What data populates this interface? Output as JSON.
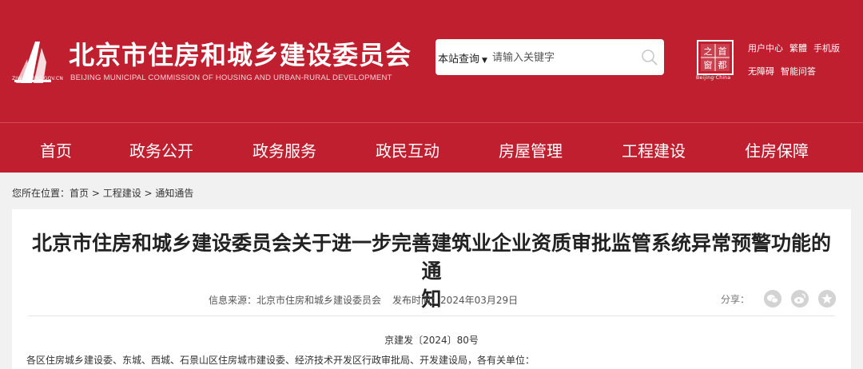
{
  "header": {
    "logo_domain": "ZJW.BEIJING.GOV.CN",
    "title": "北京市住房和城乡建设委员会",
    "subtitle": "BEIJING MUNICIPAL COMMISSION OF HOUSING AND URBAN-RURAL DEVELOPMENT",
    "seal_glyphs": [
      "首",
      "都",
      "之",
      "窗"
    ],
    "seal_caption": "Beijing·China"
  },
  "search": {
    "scope_label": "本站查询",
    "placeholder": "请输入关键字"
  },
  "top_links": {
    "user_center": "用户中心",
    "traditional": "繁體",
    "mobile": "手机版",
    "accessible": "无障碍",
    "smart_qa": "智能问答"
  },
  "nav": [
    "首页",
    "政务公开",
    "政务服务",
    "政民互动",
    "房屋管理",
    "工程建设",
    "住房保障"
  ],
  "breadcrumb": {
    "prefix": "您所在位置：",
    "home": "首页",
    "sep1": " > ",
    "section": "工程建设",
    "sep2": " > ",
    "current": "通知通告"
  },
  "article": {
    "title_line1": "北京市住房和城乡建设委员会关于进一步完善建筑业企业资质审批监管系统异常预警功能的通",
    "title_line2": "知",
    "source_label": "信息来源：",
    "source": "北京市住房和城乡建设委员会",
    "date_label": "发布时间：",
    "date": "2024年03月29日",
    "share_label": "分享：",
    "share_icons": [
      "wechat-icon",
      "weibo-icon",
      "favorite-icon"
    ],
    "doc_number": "京建发〔2024〕80号",
    "body_first_line": "各区住房城乡建设委、东城、西城、石景山区住房城市建设委、经济技术开发区行政审批局、开发建设局，各有关单位："
  },
  "colors": {
    "brand_red": "#c01f30",
    "background": "#f1f1f1"
  }
}
